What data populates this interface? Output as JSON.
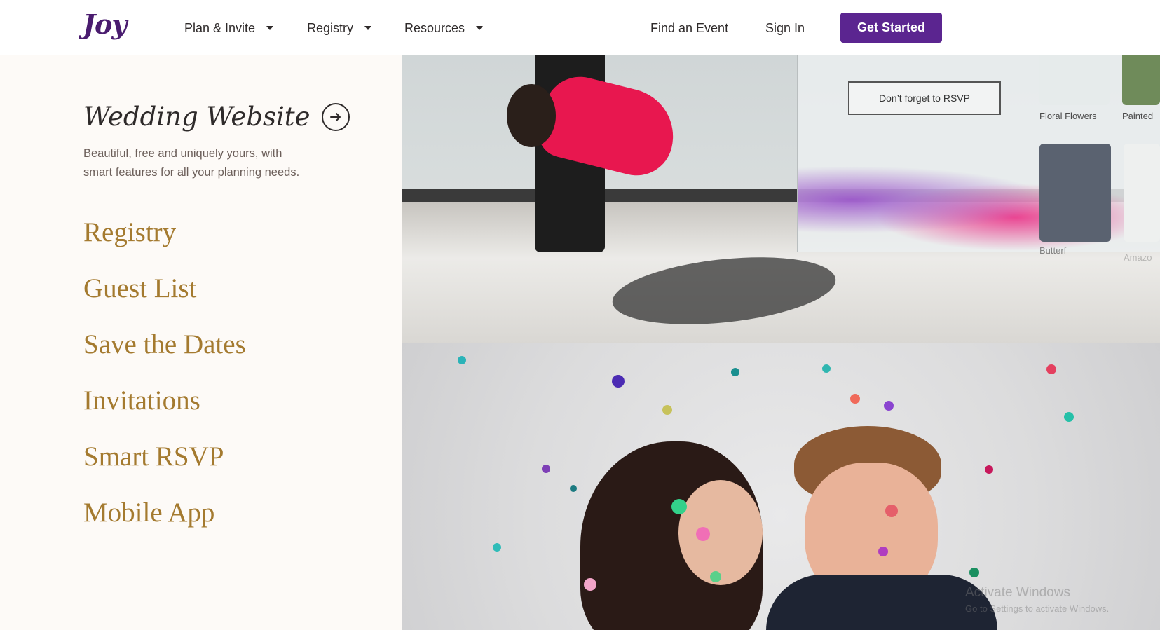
{
  "header": {
    "logo": "Joy",
    "nav": [
      {
        "label": "Plan & Invite",
        "dropdown": true
      },
      {
        "label": "Registry",
        "dropdown": true
      },
      {
        "label": "Resources",
        "dropdown": true
      }
    ],
    "find_event": "Find an Event",
    "sign_in": "Sign In",
    "get_started": "Get Started"
  },
  "feature": {
    "title": "Wedding Website",
    "description": "Beautiful, free and uniquely yours, with smart features for all your planning needs."
  },
  "menu": [
    "Registry",
    "Guest List",
    "Save the Dates",
    "Invitations",
    "Smart RSVP",
    "Mobile App"
  ],
  "photo_top": {
    "rsvp_card": "Don’t forget to RSVP",
    "tile_labels": [
      "Floral Flowers",
      "Painted",
      "Butterf",
      "Amazo"
    ]
  },
  "watermark": {
    "line1": "Activate Windows",
    "line2": "Go to Settings to activate Windows."
  },
  "colors": {
    "brand": "#5b2590",
    "menu_gold": "#a47a2f",
    "logo": "#4a1c6f"
  }
}
